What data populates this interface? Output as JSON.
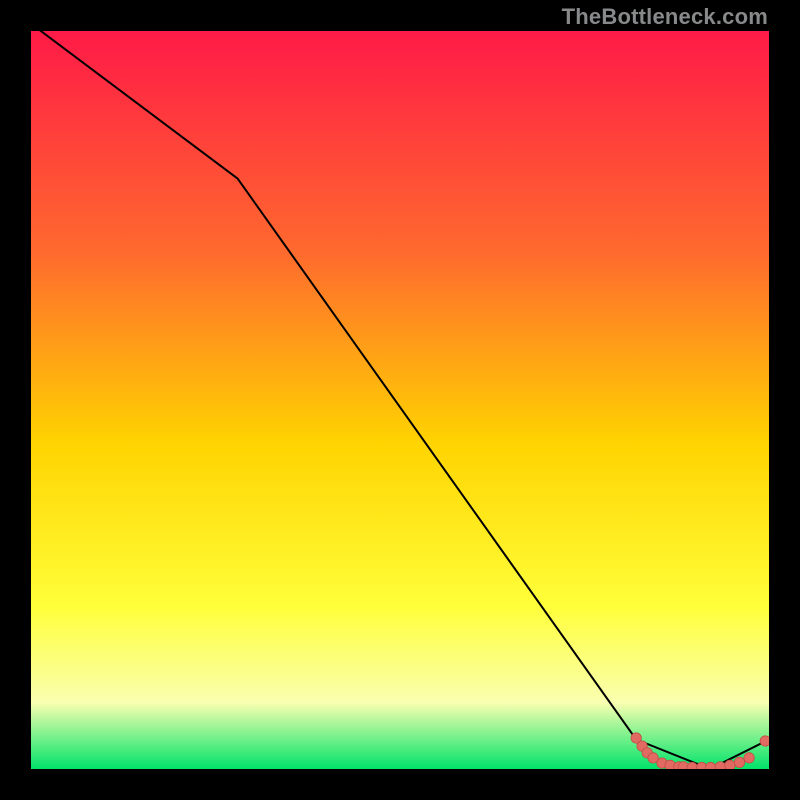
{
  "watermark": "TheBottleneck.com",
  "colors": {
    "background": "#000000",
    "gradient_top": "#ff1a47",
    "gradient_mid1": "#ff6a2e",
    "gradient_mid2": "#ffd400",
    "gradient_mid3": "#ffff3a",
    "gradient_mid4": "#f9ffb0",
    "gradient_bottom": "#00e36a",
    "line": "#000000",
    "marker_fill": "#e16a62",
    "marker_stroke": "#c24f47"
  },
  "chart_data": {
    "type": "line",
    "title": "",
    "xlabel": "",
    "ylabel": "",
    "xlim": [
      0,
      100
    ],
    "ylim": [
      0,
      100
    ],
    "series": [
      {
        "name": "curve",
        "x": [
          0,
          28,
          82,
          92,
          100
        ],
        "values": [
          101,
          80,
          4,
          0,
          4
        ]
      }
    ],
    "markers": {
      "name": "bottom-cluster",
      "points": [
        {
          "x": 82.0,
          "y": 4.2
        },
        {
          "x": 82.8,
          "y": 3.1
        },
        {
          "x": 83.5,
          "y": 2.2
        },
        {
          "x": 84.3,
          "y": 1.5
        },
        {
          "x": 85.5,
          "y": 0.8
        },
        {
          "x": 86.6,
          "y": 0.5
        },
        {
          "x": 87.8,
          "y": 0.3
        },
        {
          "x": 88.4,
          "y": 0.3
        },
        {
          "x": 89.6,
          "y": 0.2
        },
        {
          "x": 90.9,
          "y": 0.2
        },
        {
          "x": 92.1,
          "y": 0.2
        },
        {
          "x": 93.4,
          "y": 0.3
        },
        {
          "x": 94.7,
          "y": 0.5
        },
        {
          "x": 96.0,
          "y": 0.9
        },
        {
          "x": 97.3,
          "y": 1.5
        },
        {
          "x": 99.5,
          "y": 3.8
        }
      ]
    }
  }
}
